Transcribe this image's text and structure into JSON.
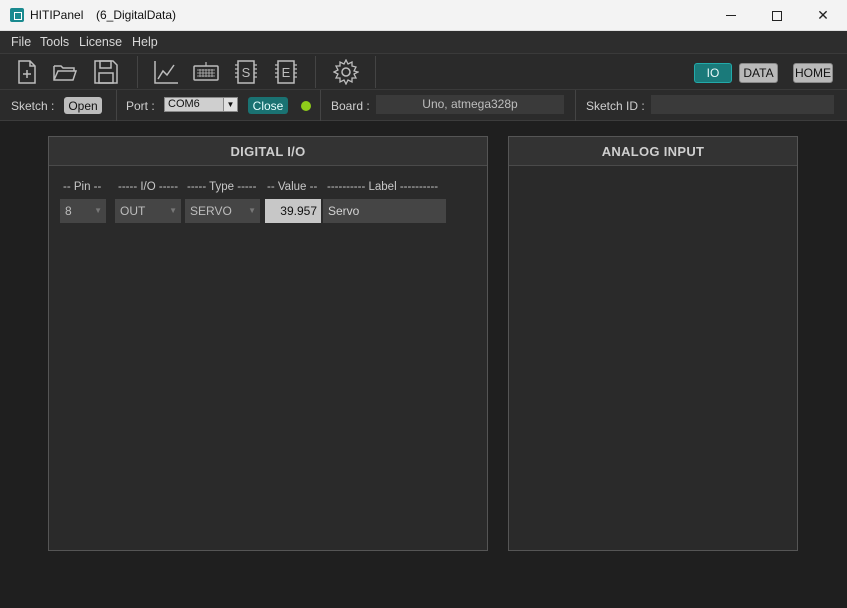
{
  "window": {
    "app_name": "HITIPanel",
    "document": "(6_DigitalData)"
  },
  "menu": {
    "items": [
      "File",
      "Tools",
      "License",
      "Help"
    ]
  },
  "toolbar": {
    "icons": [
      "new-file-icon",
      "open-folder-icon",
      "save-icon",
      "chart-icon",
      "keyboard-icon",
      "sketch-s-icon",
      "sketch-e-icon",
      "gear-icon"
    ],
    "io_label": "IO",
    "data_label": "DATA",
    "home_label": "HOME"
  },
  "statusbar": {
    "sketch_label": "Sketch :",
    "open_label": "Open",
    "port_label": "Port :",
    "port_value": "COM6",
    "close_label": "Close",
    "led_color": "#8fcc1a",
    "board_label": "Board :",
    "board_value": "Uno, atmega328p",
    "sketch_id_label": "Sketch ID :",
    "sketch_id_value": ""
  },
  "digital": {
    "title": "DIGITAL  I/O",
    "columns": {
      "pin": "-- Pin --",
      "io": "----- I/O -----",
      "type": "----- Type -----",
      "value": "-- Value --",
      "label": "---------- Label ----------"
    },
    "rows": [
      {
        "pin": "8",
        "io": "OUT",
        "type": "SERVO",
        "value": "39.957",
        "label": "Servo"
      }
    ]
  },
  "analog": {
    "title": "ANALOG  INPUT"
  },
  "colors": {
    "accent": "#1a7a7a",
    "background": "#1f1f1f",
    "panel": "#2a2a2a"
  }
}
